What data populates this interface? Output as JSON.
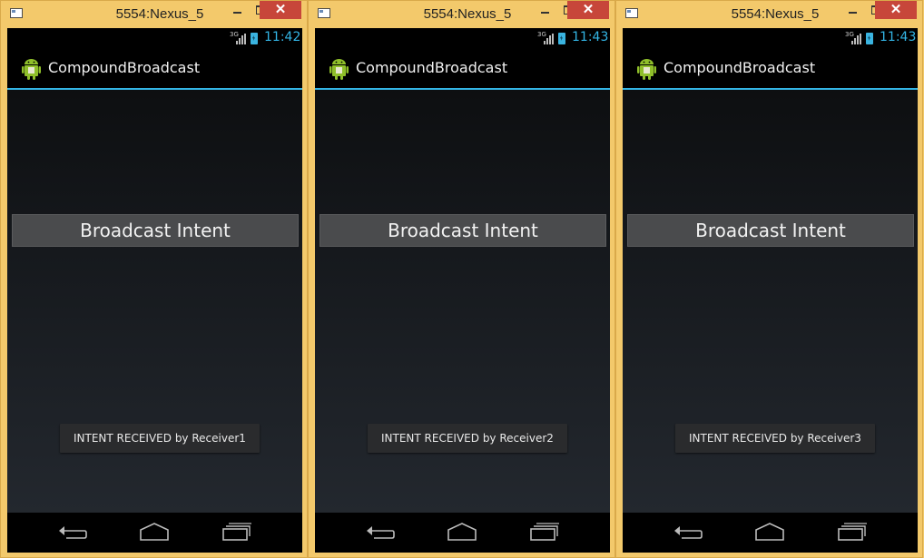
{
  "windows": [
    {
      "title": "5554:Nexus_5",
      "clock": "11:42",
      "net_label": "3G",
      "app_title": "CompoundBroadcast",
      "button_label": "Broadcast Intent",
      "toast": "INTENT RECEIVED by Receiver1",
      "close_glyph": "✕"
    },
    {
      "title": "5554:Nexus_5",
      "clock": "11:43",
      "net_label": "3G",
      "app_title": "CompoundBroadcast",
      "button_label": "Broadcast Intent",
      "toast": "INTENT RECEIVED by Receiver2",
      "close_glyph": "✕"
    },
    {
      "title": "5554:Nexus_5",
      "clock": "11:43",
      "net_label": "3G",
      "app_title": "CompoundBroadcast",
      "button_label": "Broadcast Intent",
      "toast": "INTENT RECEIVED by Receiver3",
      "close_glyph": "✕"
    }
  ],
  "icons": {
    "app": "android-icon",
    "back": "back-icon",
    "home": "home-icon",
    "recent": "recent-apps-icon"
  },
  "colors": {
    "accent": "#33b5e5",
    "window_frame": "#f3c96b",
    "close_button": "#c7463a"
  }
}
